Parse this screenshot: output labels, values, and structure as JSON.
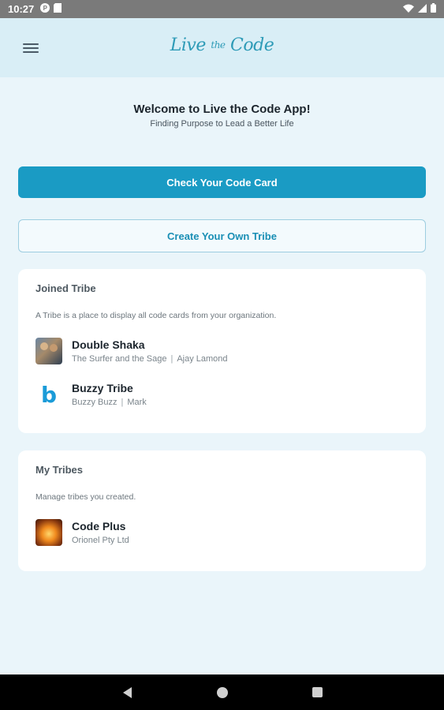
{
  "status_bar": {
    "time": "10:27",
    "icons": [
      "notification-p-icon",
      "sd-card-icon",
      "wifi-icon",
      "signal-icon",
      "battery-icon"
    ]
  },
  "app_bar": {
    "logo_main": "Live",
    "logo_small": "the",
    "logo_end": "Code"
  },
  "welcome": {
    "title": "Welcome to Live the Code App!",
    "subtitle": "Finding Purpose to Lead a Better Life"
  },
  "buttons": {
    "check_code_card": "Check Your Code Card",
    "create_tribe": "Create Your Own Tribe"
  },
  "joined_tribe": {
    "heading": "Joined Tribe",
    "description": "A Tribe is a place to display all code cards from your organization.",
    "items": [
      {
        "name": "Double Shaka",
        "org": "The Surfer and the Sage",
        "separator": "|",
        "owner": "Ajay Lamond"
      },
      {
        "name": "Buzzy Tribe",
        "org": "Buzzy Buzz",
        "separator": "|",
        "owner": "Mark",
        "logo_letter": "b"
      }
    ]
  },
  "my_tribes": {
    "heading": "My Tribes",
    "description": "Manage tribes you created.",
    "items": [
      {
        "name": "Code Plus",
        "org": "Orionel Pty Ltd"
      }
    ]
  },
  "colors": {
    "accent": "#1a9bc4",
    "app_bar_bg": "#d9eef6",
    "page_bg": "#eaf5fa"
  }
}
